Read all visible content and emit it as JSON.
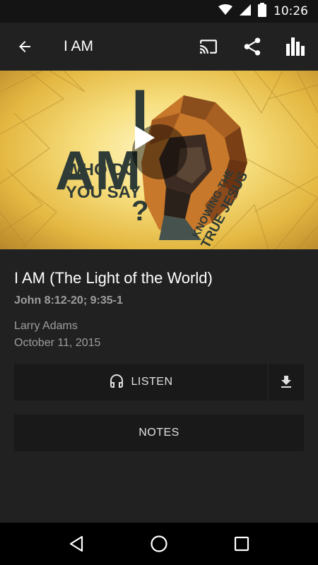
{
  "status_bar": {
    "time": "10:26",
    "icons": [
      "wifi-icon",
      "signal-icon",
      "battery-icon"
    ]
  },
  "app_bar": {
    "title": "I AM",
    "actions": [
      "cast-icon",
      "share-icon",
      "stats-icon"
    ]
  },
  "hero": {
    "artwork_text": {
      "line1": "WHO DO",
      "line2": "YOU SAY",
      "big_i": "I",
      "big_am": "AM",
      "question": "?",
      "side_line1": "KNOWING THE",
      "side_line2": "TRUE JESUS"
    },
    "play_icon": "play-icon"
  },
  "sermon": {
    "title": "I AM (The Light of the World)",
    "scripture": "John 8:12-20; 9:35-1",
    "speaker": "Larry Adams",
    "date": "October 11, 2015"
  },
  "actions": {
    "listen_label": "LISTEN",
    "listen_icon": "headphones-icon",
    "download_icon": "download-icon",
    "notes_label": "NOTES"
  },
  "nav_bar": {
    "icons": [
      "back-triangle-icon",
      "home-circle-icon",
      "recents-square-icon"
    ]
  },
  "colors": {
    "background": "#212121",
    "button_bg": "#191919",
    "secondary_text": "#9e9e9e",
    "artwork_dark": "#2f3b36"
  }
}
